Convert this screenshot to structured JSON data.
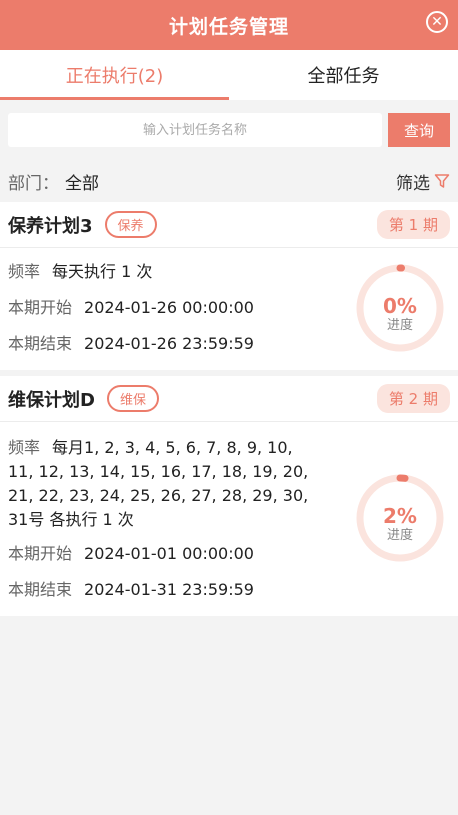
{
  "header": {
    "title": "计划任务管理",
    "close_icon": "close-circle-icon"
  },
  "tabs": [
    {
      "label": "正在执行(2)",
      "active": true
    },
    {
      "label": "全部任务",
      "active": false
    }
  ],
  "search": {
    "placeholder": "输入计划任务名称",
    "value": "",
    "button_label": "查询"
  },
  "filter": {
    "dept_label": "部门：",
    "dept_value": "全部",
    "filter_label": "筛选",
    "filter_icon": "filter-icon"
  },
  "accent_color": "#ec7c6b",
  "tasks": [
    {
      "name": "保养计划3",
      "tag": "保养",
      "period": "第 1 期",
      "freq_label": "频率",
      "freq_value": "每天执行 1 次",
      "start_label": "本期开始",
      "start_value": "2024-01-26 00:00:00",
      "end_label": "本期结束",
      "end_value": "2024-01-26 23:59:59",
      "progress_text": "0%",
      "progress_value": 0,
      "progress_label": "进度"
    },
    {
      "name": "维保计划D",
      "tag": "维保",
      "period": "第 2 期",
      "freq_label": "频率",
      "freq_value": "每月1, 2, 3, 4, 5, 6, 7, 8, 9, 10, 11, 12, 13, 14, 15, 16, 17, 18, 19, 20, 21, 22, 23, 24, 25, 26, 27, 28, 29, 30, 31号 各执行 1 次",
      "start_label": "本期开始",
      "start_value": "2024-01-01 00:00:00",
      "end_label": "本期结束",
      "end_value": "2024-01-31 23:59:59",
      "progress_text": "2%",
      "progress_value": 2,
      "progress_label": "进度"
    }
  ]
}
